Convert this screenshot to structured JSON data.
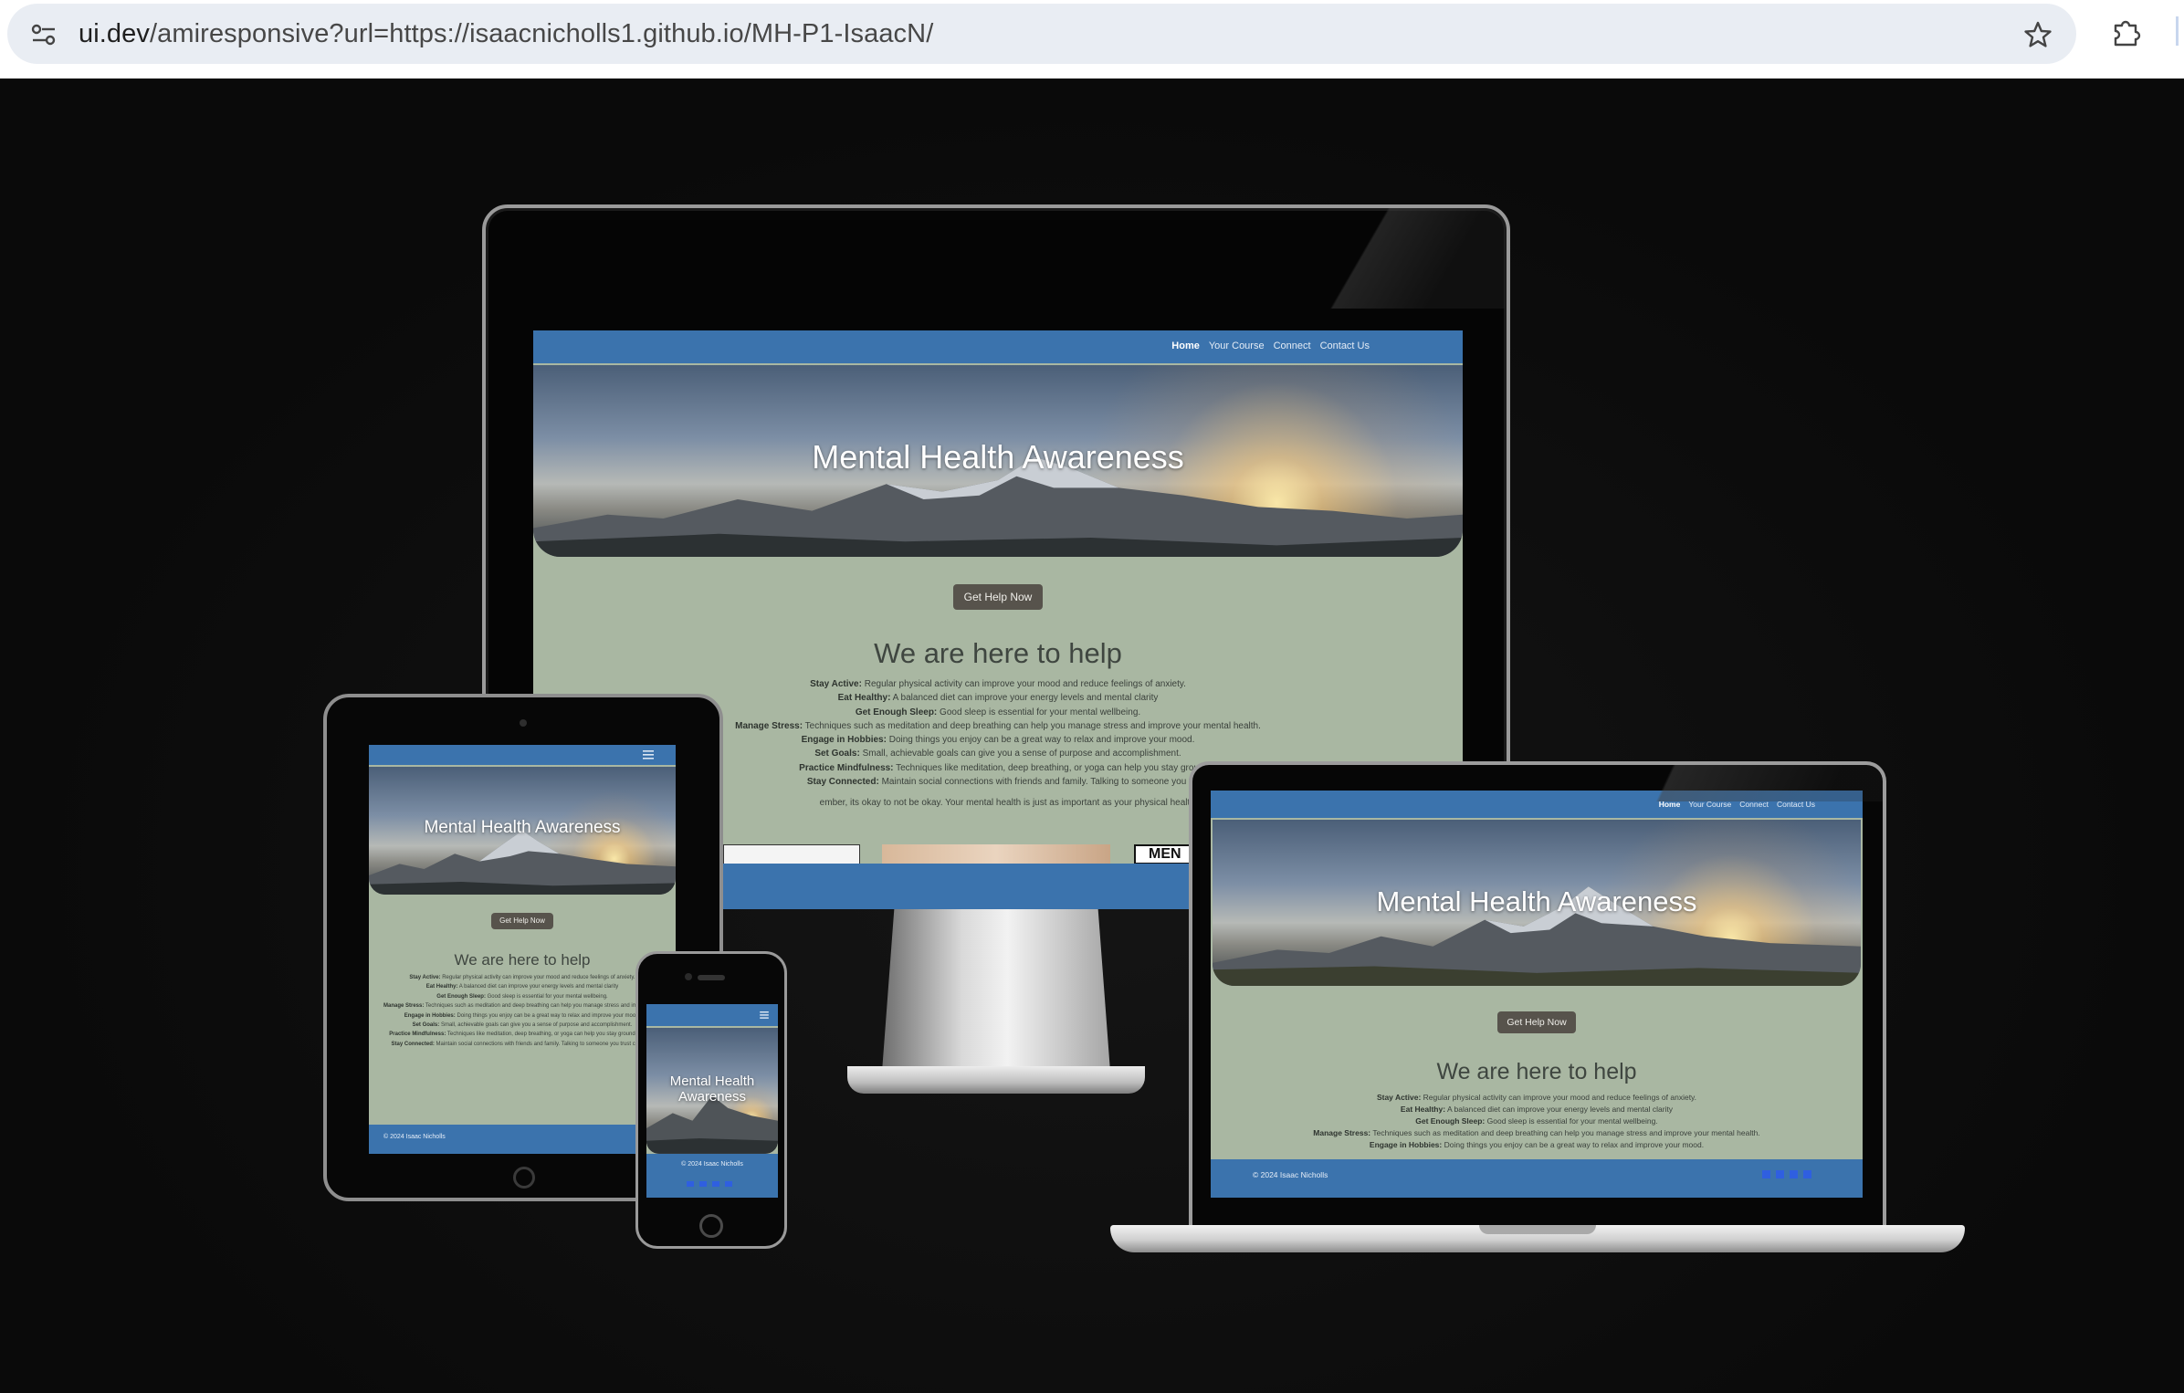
{
  "browser": {
    "url_host": "ui.dev",
    "url_path": "/amiresponsive?url=https://isaacnicholls1.github.io/MH-P1-IsaacN/"
  },
  "site": {
    "nav": {
      "home": "Home",
      "course": "Your Course",
      "connect": "Connect",
      "contact": "Contact Us"
    },
    "hero_title": "Mental Health Awareness",
    "hero_title_line1": "Mental Health",
    "hero_title_line2": "Awareness",
    "help_button": "Get Help Now",
    "section_title": "We are here to help",
    "tips": [
      {
        "label": "Stay Active:",
        "text": "Regular physical activity can improve your mood and reduce feelings of anxiety."
      },
      {
        "label": "Eat Healthy:",
        "text": "A balanced diet can improve your energy levels and mental clarity"
      },
      {
        "label": "Get Enough Sleep:",
        "text": "Good sleep is essential for your mental wellbeing."
      },
      {
        "label": "Manage Stress:",
        "text": "Techniques such as meditation and deep breathing can help you manage stress and improve your mental health."
      },
      {
        "label": "Engage in Hobbies:",
        "text": "Doing things you enjoy can be a great way to relax and improve your mood."
      },
      {
        "label": "Set Goals:",
        "text": "Small, achievable goals can give you a sense of purpose and accomplishment."
      },
      {
        "label": "Practice Mindfulness:",
        "text": "Techniques like meditation, deep breathing, or yoga can help you stay grounded and r"
      },
      {
        "label": "Stay Connected:",
        "text": "Maintain social connections with friends and family. Talking to someone you trust can be v"
      }
    ],
    "remember": "ember, its okay to not be okay. Your mental health is just as important as your physical health, and its okay to ask fo",
    "remember_full": "Remember, its okay to not be okay. Your mental health is just as important as your physical health, and its okay to ask for help when you need it",
    "card_label": "MEN",
    "footer": "© 2024 Isaac Nicholls"
  }
}
